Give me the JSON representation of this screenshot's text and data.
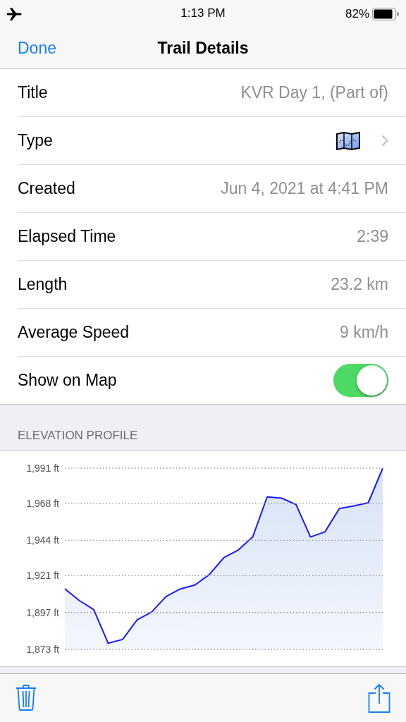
{
  "status_bar": {
    "time": "1:13 PM",
    "battery": "82%"
  },
  "nav": {
    "back": "Done",
    "title": "Trail Details"
  },
  "rows": [
    {
      "kind": "text",
      "label": "Title",
      "value": "KVR Day 1, (Part of)"
    },
    {
      "kind": "link",
      "label": "Type"
    },
    {
      "kind": "text",
      "label": "Created",
      "value": "Jun 4, 2021 at 4:41 PM"
    },
    {
      "kind": "text",
      "label": "Elapsed Time",
      "value": "2:39"
    },
    {
      "kind": "text",
      "label": "Length",
      "value": "23.2 km"
    },
    {
      "kind": "text",
      "label": "Average Speed",
      "value": "9 km/h"
    },
    {
      "kind": "toggle",
      "label": "Show on Map",
      "on": true
    }
  ],
  "elevation": {
    "header": "ELEVATION PROFILE",
    "chart_data": {
      "type": "area",
      "grid": true,
      "categories": [
        null,
        null,
        null,
        null,
        null,
        null,
        null,
        null,
        null,
        null,
        null,
        null,
        null,
        null,
        null,
        null,
        null,
        null,
        null,
        null,
        null,
        null,
        null
      ],
      "ylim": [
        1873,
        1991
      ],
      "series": [
        {
          "color": "#1a1aff",
          "values": [
            1912.5,
            1904.8,
            1898.9,
            1877,
            1879.5,
            1892.2,
            1897.3,
            1907.4,
            1912.4,
            1914.9,
            1921.7,
            1932.7,
            1937.7,
            1946.2,
            1972.3,
            1971.5,
            1967.3,
            1946.2,
            1949.5,
            1964.7,
            1966.4,
            1968.5,
            1991
          ]
        }
      ],
      "yticks": [
        {
          "value": 1991,
          "label": "1,991 ft"
        },
        {
          "value": 1968,
          "label": "1,968 ft"
        },
        {
          "value": 1944,
          "label": "1,944 ft"
        },
        {
          "value": 1921,
          "label": "1,921 ft"
        },
        {
          "value": 1897,
          "label": "1,897 ft"
        },
        {
          "value": 1873,
          "label": "1,873 ft"
        }
      ]
    }
  }
}
